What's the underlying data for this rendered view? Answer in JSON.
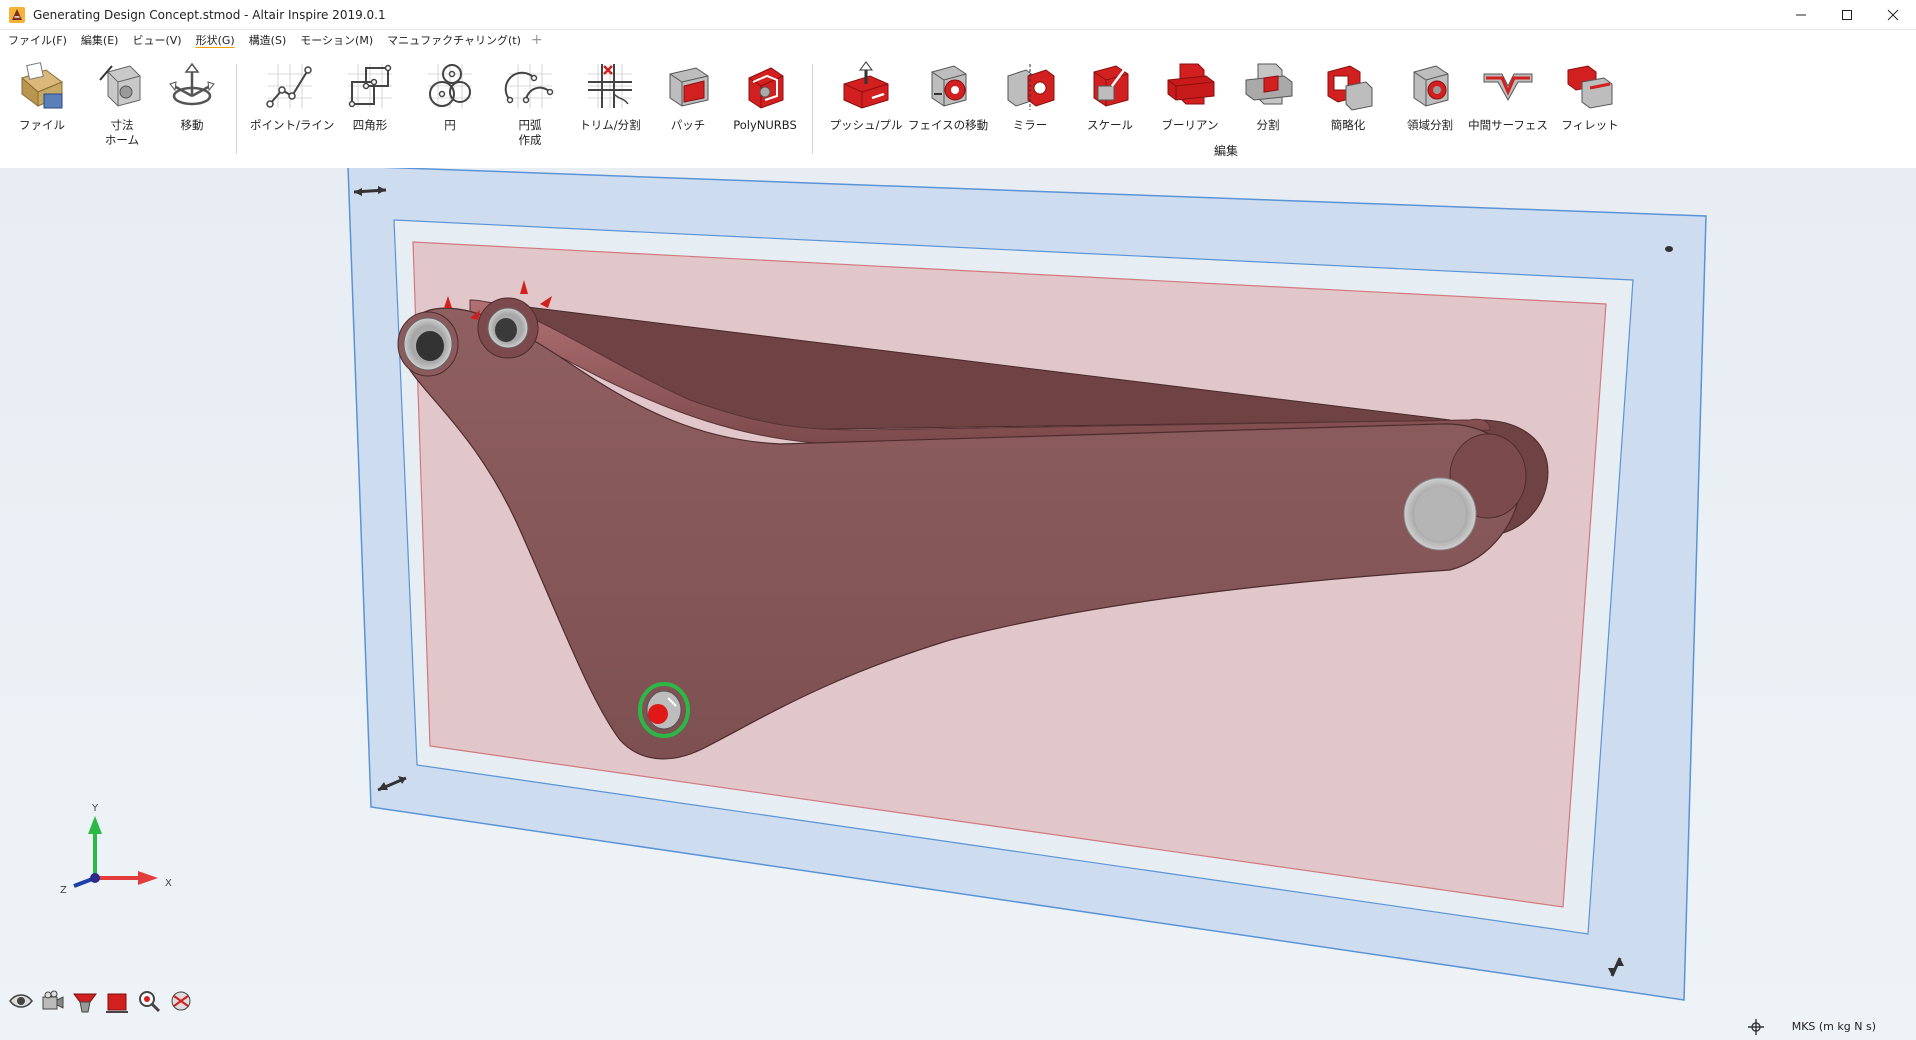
{
  "window": {
    "title": "Generating Design Concept.stmod - Altair Inspire 2019.0.1"
  },
  "menu": {
    "items": [
      {
        "id": "file",
        "label": "ファイル(F)"
      },
      {
        "id": "edit",
        "label": "編集(E)"
      },
      {
        "id": "view",
        "label": "ビュー(V)"
      },
      {
        "id": "geometry",
        "label": "形状(G)",
        "active": true
      },
      {
        "id": "structure",
        "label": "構造(S)"
      },
      {
        "id": "motion",
        "label": "モーション(M)"
      },
      {
        "id": "manufacturing",
        "label": "マニュファクチャリング(t)"
      }
    ],
    "plus": "+"
  },
  "ribbon": {
    "tools": [
      {
        "id": "file",
        "label": "ファイル",
        "icon": "file-folder-icon"
      },
      {
        "id": "dimension",
        "label": "寸法\nホーム",
        "icon": "dimension-icon"
      },
      {
        "id": "move",
        "label": "移動",
        "icon": "move-icon"
      },
      {
        "id": "point-line",
        "label": "ポイント/ライン",
        "icon": "point-line-icon"
      },
      {
        "id": "rectangle",
        "label": "四角形",
        "icon": "rectangle-icon"
      },
      {
        "id": "circle",
        "label": "円",
        "icon": "circle-icon"
      },
      {
        "id": "arc",
        "label": "円弧\n作成",
        "icon": "arc-icon"
      },
      {
        "id": "trim",
        "label": "トリム/分割",
        "icon": "trim-icon"
      },
      {
        "id": "patch",
        "label": "パッチ",
        "icon": "patch-icon"
      },
      {
        "id": "polynurbs",
        "label": "PolyNURBS",
        "icon": "polynurbs-icon"
      },
      {
        "id": "push-pull",
        "label": "プッシュ/プル",
        "icon": "push-pull-icon"
      },
      {
        "id": "move-face",
        "label": "フェイスの移動",
        "icon": "move-face-icon"
      },
      {
        "id": "mirror",
        "label": "ミラー",
        "icon": "mirror-icon"
      },
      {
        "id": "scale",
        "label": "スケール",
        "icon": "scale-icon"
      },
      {
        "id": "boolean",
        "label": "ブーリアン",
        "icon": "boolean-icon"
      },
      {
        "id": "split",
        "label": "分割",
        "icon": "split-icon"
      },
      {
        "id": "simplify",
        "label": "簡略化",
        "icon": "simplify-icon"
      },
      {
        "id": "partition",
        "label": "領域分割",
        "icon": "partition-icon"
      },
      {
        "id": "midsurface",
        "label": "中間サーフェス",
        "icon": "midsurface-icon"
      },
      {
        "id": "fillet",
        "label": "フィレット",
        "icon": "fillet-icon"
      }
    ],
    "group_edit_label": "編集"
  },
  "axes": {
    "x": "X",
    "y": "Y",
    "z": "Z"
  },
  "status": {
    "units": "MKS (m kg N s)"
  },
  "colors": {
    "part_fill": "#8a5a5c",
    "design_space": "#e7c9cb",
    "plane_fill": "#cdddef",
    "plane_border": "#5a94d6",
    "accent_red": "#d21f1f"
  }
}
